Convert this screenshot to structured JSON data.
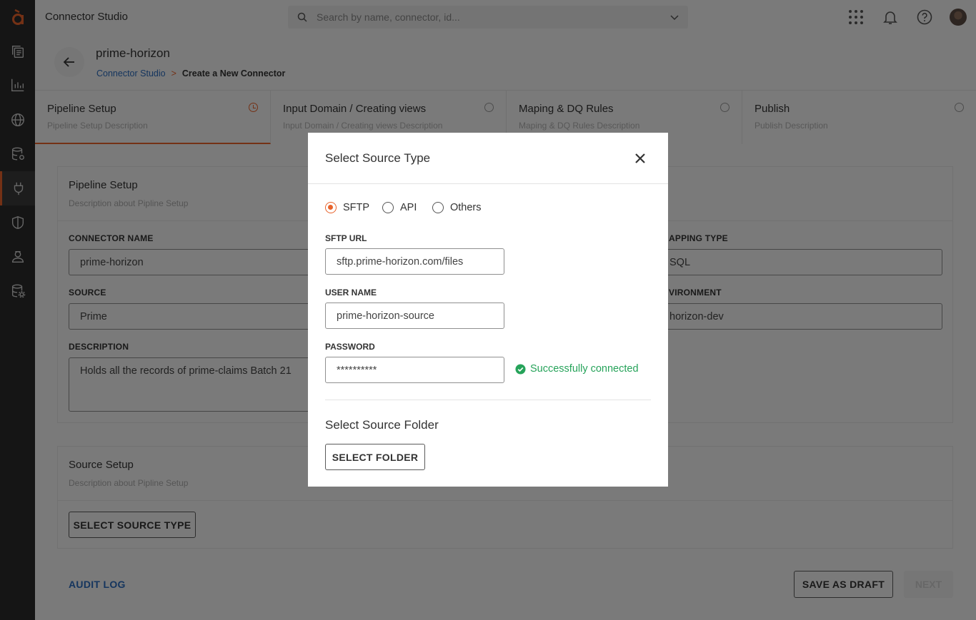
{
  "app": {
    "title": "Connector Studio",
    "search_placeholder": "Search by name, connector, id...",
    "accent_color": "#e8632b",
    "link_color": "#2a6bbd",
    "success_color": "#26a35a"
  },
  "sidebar": {
    "logo": "logo-a",
    "items": [
      {
        "icon": "files-icon"
      },
      {
        "icon": "chart-icon"
      },
      {
        "icon": "globe-icon"
      },
      {
        "icon": "database-settings-icon"
      },
      {
        "icon": "plug-icon",
        "active": true
      },
      {
        "icon": "shield-icon"
      },
      {
        "icon": "user-badge-icon"
      },
      {
        "icon": "database-gear-icon"
      }
    ]
  },
  "page": {
    "title": "prime-horizon",
    "breadcrumb": {
      "parent": "Connector Studio",
      "separator": ">",
      "current": "Create a New Connector"
    }
  },
  "steps": [
    {
      "title": "Pipeline Setup",
      "desc": "Pipeline Setup Description",
      "active": true
    },
    {
      "title": "Input Domain / Creating views",
      "desc": "Input Domain / Creating views Description"
    },
    {
      "title": "Maping & DQ Rules",
      "desc": "Maping & DQ Rules Description"
    },
    {
      "title": "Publish",
      "desc": "Publish Description"
    }
  ],
  "pipeline": {
    "title": "Pipeline Setup",
    "desc": "Description about Pipline Setup",
    "connector_name_label": "CONNECTOR NAME",
    "connector_name": "prime-horizon",
    "source_label": "SOURCE",
    "source": "Prime",
    "description_label": "DESCRIPTION",
    "description": "Holds all the records of prime-claims Batch 21",
    "mapping_type_label": "APPING TYPE",
    "mapping_type": "SQL",
    "environment_label": "VIRONMENT",
    "environment": "horizon-dev"
  },
  "source_setup": {
    "title": "Source Setup",
    "desc": "Description about Pipline Setup",
    "button": "SELECT SOURCE TYPE"
  },
  "footer": {
    "audit_log": "AUDIT LOG",
    "save_draft": "SAVE AS DRAFT",
    "next": "NEXT"
  },
  "modal": {
    "title": "Select Source Type",
    "radios": [
      {
        "label": "SFTP",
        "checked": true
      },
      {
        "label": "API",
        "checked": false
      },
      {
        "label": "Others",
        "checked": false
      }
    ],
    "sftp_url_label": "SFTP URL",
    "sftp_url": "sftp.prime-horizon.com/files",
    "user_name_label": "USER NAME",
    "user_name": "prime-horizon-source",
    "password_label": "PASSWORD",
    "password": "**********",
    "status": "Successfully connected",
    "folder_title": "Select Source Folder",
    "folder_button": "SELECT FOLDER"
  }
}
